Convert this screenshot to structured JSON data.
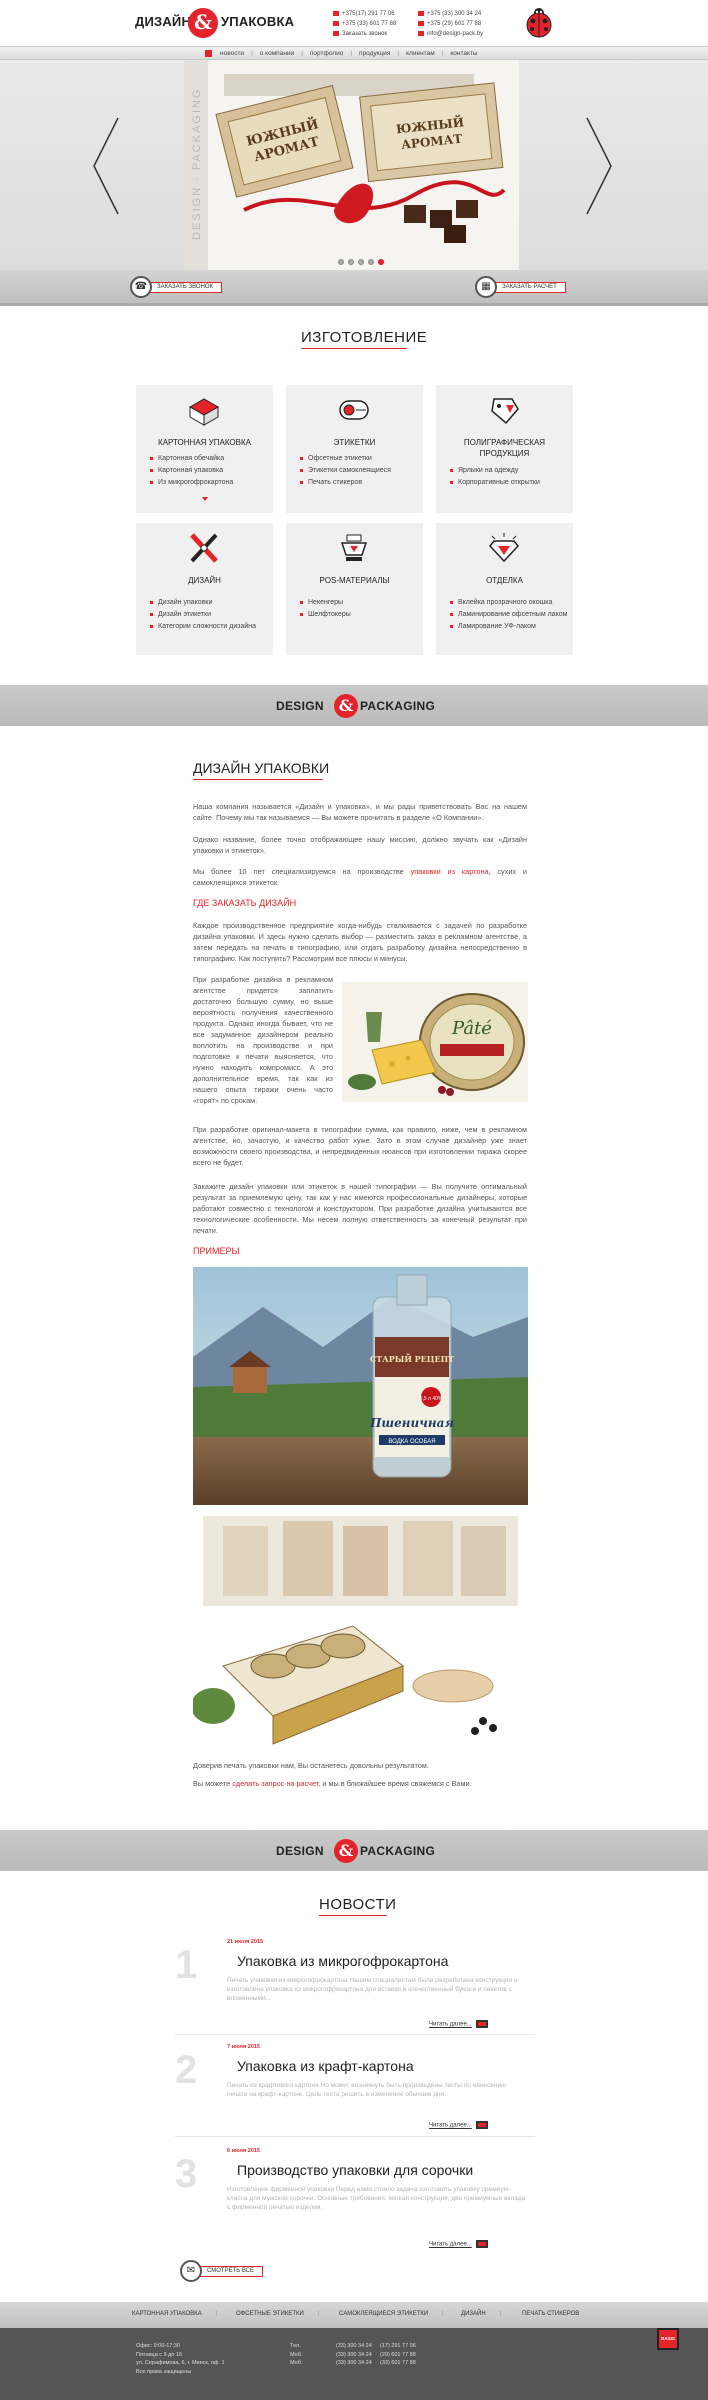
{
  "header": {
    "logo_left": "ДИЗАЙН",
    "logo_amp": "&",
    "logo_right": "УПАКОВКА",
    "phones_col1": [
      "+375(17) 291 77 06",
      "+375 (33) 601 77 88",
      "Заказать звонок"
    ],
    "phones_col2": [
      "+375 (33) 300 34 24",
      "+375 (29) 601 77 88",
      "info@design-pack.by"
    ]
  },
  "nav": {
    "items": [
      "новости",
      "о компании",
      "портфолио",
      "продукция",
      "клиентам",
      "контакты"
    ]
  },
  "slider": {
    "vertical_text": "DESIGN · PACKAGING",
    "box1": "ЮЖНЫЙ АРОМАТ",
    "box2": "ЮЖНЫЙ АРОМАТ",
    "dots": 5,
    "active_dot": 5
  },
  "actions": {
    "call_label": "ЗАКАЗАТЬ ЗВОНОК",
    "calc_label": "ЗАКАЗАТЬ РАСЧЕТ"
  },
  "production": {
    "title": "ИЗГОТОВЛЕНИЕ",
    "cards": [
      {
        "title": "КАРТОННАЯ УПАКОВКА",
        "items": [
          "Картонная обечайка",
          "Картонная упаковка",
          "Из микрогофрокартона"
        ]
      },
      {
        "title": "ЭТИКЕТКИ",
        "items": [
          "Офсетные этикетки",
          "Этикетки самоклеящиеся",
          "Печать стикеров"
        ]
      },
      {
        "title": "ПОЛИГРАФИЧЕСКАЯ ПРОДУКЦИЯ",
        "items": [
          "Ярлыки на одежду",
          "Корпоративные открытки"
        ]
      },
      {
        "title": "ДИЗАЙН",
        "items": [
          "Дизайн упаковки",
          "Дизайн этикетки",
          "Категории сложности дизайна"
        ]
      },
      {
        "title": "POS-МАТЕРИАЛЫ",
        "items": [
          "Некенгеры",
          "Шелфтокеры"
        ]
      },
      {
        "title": "ОТДЕЛКА",
        "items": [
          "Вклейка прозрачного окошка",
          "Ламинирование офсетным лаком",
          "Ламирование УФ-лаком"
        ]
      }
    ]
  },
  "banner": {
    "left": "DESIGN",
    "amp": "&",
    "right": "PACKAGING"
  },
  "article": {
    "title": "ДИЗАЙН УПАКОВКИ",
    "p1": "Наша компания называется «Дизайн и упаковка», и мы рады приветствовать Вас на нашем сайте. Почему мы так называемся — Вы можете прочитать в разделе «О Компании».",
    "p2": "Однако название, более точно отображающее нашу миссию, должно звучать как «Дизайн упаковки и этикеток».",
    "p3a": "Мы более 10 лет специализируемся на производстве ",
    "p3link": "упаковки из картона",
    "p3b": ", сухих и самоклеящихся этикеток.",
    "h_order": "ГДЕ ЗАКАЗАТЬ ДИЗАЙН",
    "p4": "Каждое производственное предприятие когда-нибудь сталкивается с задачей по разработке дизайна упаковки. И здесь нужно сделать выбор — разместить заказ в рекламном агентстве, а затем передать на печать в типографию, или отдать разработку дизайна непосредственно в типографию. Как поступить? Рассмотрим все плюсы и минусы.",
    "p5": "При разработке дизайна в рекламном агентстве придется заплатить достаточно большую сумму, но выше вероятность получения качественного продукта. Однако иногда бывает, что не все задуманное дизайнером реально воплотить на производстве и при подготовке к печати выясняется, что нужно находить компромисс. А это дополнительное время, так как из нашего опыта тиражи очень часто «горят» по срокам.",
    "p6": "При разработке оригинал-макета в типографии сумма, как правило, ниже, чем в рекламном агентстве, но, зачастую, и качество работ хуже. Зато в этом случае дизайнер уже знает возможности своего производства, и непредвиденных нюансов при изготовлении тиража скорее всего не будет.",
    "p7": "Закажите дизайн упаковки или этикеток в нашей типографии — Вы получите оптимальный результат за приемлемую цену, так как у нас имеются профессиональные дизайнеры, которые работают совместно с технологом и конструктором. При разработке дизайна учитываются все технологические особенности. Мы несем полную ответственность за конечный результат при печати.",
    "h_examples": "ПРИМЕРЫ",
    "pate_brand": "Pâté",
    "vodka_brand": "Пшеничная",
    "vodka_small": "ВОДКА ОСОБАЯ",
    "vodka_top": "СТАРЫЙ РЕЦЕПТ",
    "vodka_vol": "0,5 л 40%",
    "p8": "Доверив печать упаковки нам, Вы останетесь довольны результатом.",
    "p9a": "Вы можете ",
    "p9link": "сделать запрос на расчет",
    "p9b": ", и мы в ближайшее время свяжемся с Вами."
  },
  "news": {
    "title": "НОВОСТИ",
    "items": [
      {
        "num": "1",
        "date": "21 июля 2015",
        "title": "Упаковка из микрогофрокартона",
        "text": "Печать упаковки из микрогофрокартона Нашим специалистам была разработана конструкция и изготовлена упаковка из микрогофрокартона для вставки в отечественный бумаги и пакетов с вложенными...",
        "more": "Читать далее..."
      },
      {
        "num": "2",
        "date": "7 июля 2015",
        "title": "Упаковка из крафт-картона",
        "text": "Печать из крафтового картона Но может возникнуть быть произведены тесты по нанесению печати на крафт-картоне. Цель теста решить в изменение обычаев дня.",
        "more": "Читать далее..."
      },
      {
        "num": "3",
        "date": "6 июля 2015",
        "title": "Производство упаковки для сорочки",
        "text": "Изготовление фирменной упаковки Перед нами стояло задача изготовить упаковку премиум-класса для мужской сорочки. Основные требования: мягкая конструкция, два премиумные вклада с фирменной печатью изделия.",
        "more": "Читать далее..."
      }
    ],
    "all_label": "СМОТРЕТЬ ВСЕ"
  },
  "footer": {
    "nav": [
      "КАРТОННАЯ УПАКОВКА",
      "ОФСЕТНЫЕ ЭТИКЕТКИ",
      "САМОКЛЕЯЩИЕСЯ ЭТИКЕТКИ",
      "ДИЗАЙН",
      "ПЕЧАТЬ СТИКЕРОВ"
    ],
    "address": [
      "Офис: 9:00-17:30",
      "Пятница с 9 до 16",
      "ул. Серафимова, 6, г. Минск, оф. 1",
      "Все права защищены"
    ],
    "phones_labels": [
      "Тел.",
      "Моб.",
      "Моб."
    ],
    "phones_a": [
      "(33) 300 34 24",
      "(33) 300 34 24",
      "(33) 300 34 24"
    ],
    "phones_b": [
      "(17) 291 77 06",
      "(29) 601 77 88",
      "(33) 601 77 88"
    ],
    "badge": "BASIS"
  },
  "colors": {
    "accent": "#e4232b",
    "footer_bg": "#555555"
  }
}
